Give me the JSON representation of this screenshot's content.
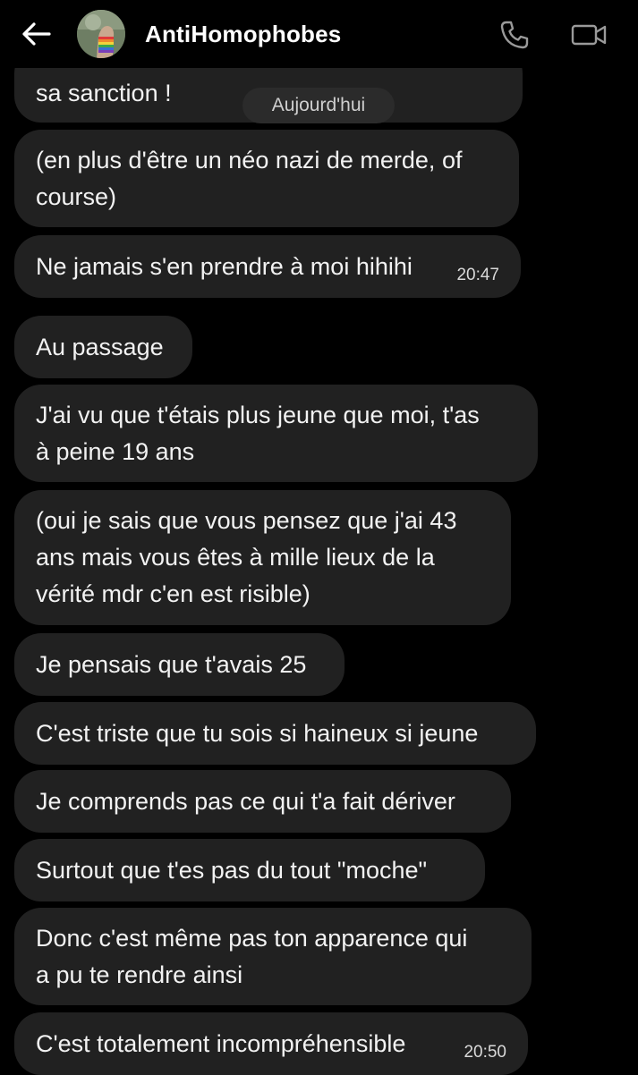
{
  "header": {
    "contact_name": "AntiHomophobes",
    "back_icon": "arrow-left-icon",
    "call_icon": "phone-icon",
    "video_icon": "video-camera-icon"
  },
  "date_separator": "Aujourd'hui",
  "messages": [
    {
      "text": "sa sanction !",
      "time": ""
    },
    {
      "text": "(en plus d'être un néo nazi de merde, of\ncourse)",
      "time": ""
    },
    {
      "text": "Ne jamais s'en prendre à moi hihihi",
      "time": "20:47"
    },
    {
      "text": "Au passage",
      "time": ""
    },
    {
      "text": "J'ai vu que t'étais plus jeune que moi, t'as\nà peine 19 ans",
      "time": ""
    },
    {
      "text": "(oui je sais que vous pensez que j'ai 43\nans mais vous êtes à mille lieux de la\nvérité mdr c'en est risible)",
      "time": ""
    },
    {
      "text": "Je pensais que t'avais 25",
      "time": ""
    },
    {
      "text": "C'est triste que tu sois si haineux si jeune",
      "time": ""
    },
    {
      "text": "Je comprends pas ce qui t'a fait dériver",
      "time": ""
    },
    {
      "text": "Surtout que t'es pas du tout \"moche\"",
      "time": ""
    },
    {
      "text": "Donc c'est même pas ton apparence qui\na pu te rendre ainsi",
      "time": ""
    },
    {
      "text": "C'est totalement incompréhensible",
      "time": "20:50"
    }
  ],
  "colors": {
    "background": "#000000",
    "bubble": "#212121",
    "text": "#f2f2f2",
    "timestamp": "#d9d9d9"
  }
}
